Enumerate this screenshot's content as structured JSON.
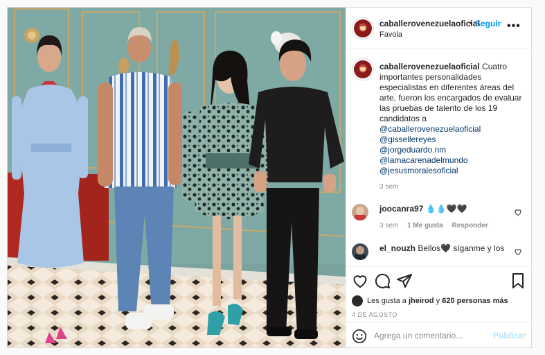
{
  "post": {
    "username": "caballerovenezuelaoficial",
    "separator": "•",
    "follow_label": "Seguir",
    "location": "Favola",
    "more_label": "•••"
  },
  "caption": {
    "username": "caballerovenezuelaoficial",
    "text": "Cuatro importantes personalidades especialistas en diferentes áreas del arte, fueron los encargados de evaluar las pruebas de talento de los 19 candidatos a",
    "mentions": [
      "@caballerovenezuelaoficial",
      "@gissellereyes",
      "@jorgeduardo.nm",
      "@lamacarenadelmundo",
      "@jesusmoralesoficial"
    ],
    "time": "3 sem"
  },
  "comments": [
    {
      "username": "joocanra97",
      "text": "💧💧🖤🖤",
      "time": "3 sem",
      "likes": "1 Me gusta",
      "reply_label": "Responder"
    },
    {
      "username": "el_nouzh",
      "text": "Bellos🖤 síganme y los"
    }
  ],
  "likes": {
    "prefix": "Les gusta a",
    "user": "jheirod",
    "connector": "y",
    "count": "620 personas más"
  },
  "date": "4 DE AGOSTO",
  "comment_box": {
    "placeholder": "Agrega un comentario...",
    "publish_label": "Publicar"
  },
  "colors": {
    "link": "#0095f6",
    "mention": "#00376b",
    "muted": "#8e8e8e",
    "publish_disabled": "#b2dffc"
  }
}
